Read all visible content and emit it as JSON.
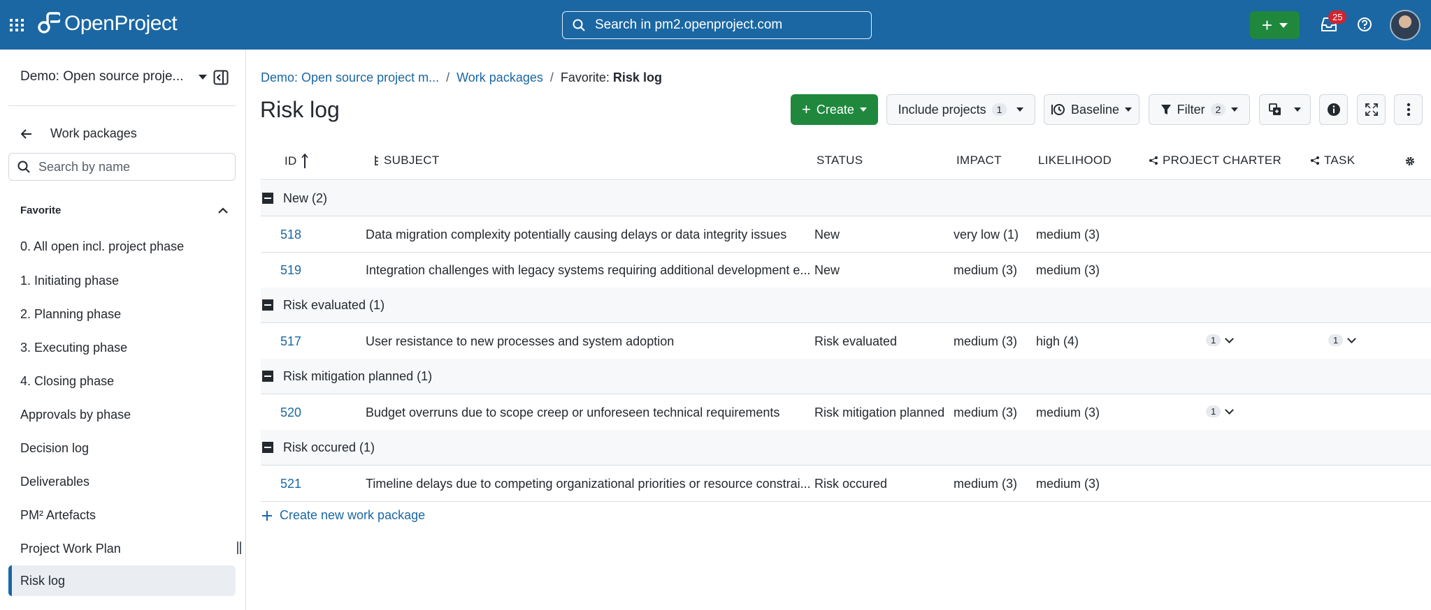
{
  "header": {
    "app_name": "OpenProject",
    "search_placeholder": "Search in pm2.openproject.com",
    "notification_count": "25"
  },
  "sidebar": {
    "project_name": "Demo: Open source proje...",
    "back_label": "Work packages",
    "search_placeholder": "Search by name",
    "section_title": "Favorite",
    "items": [
      {
        "label": "0. All open incl. project phase"
      },
      {
        "label": "1. Initiating phase"
      },
      {
        "label": "2. Planning phase"
      },
      {
        "label": "3. Executing phase"
      },
      {
        "label": "4. Closing phase"
      },
      {
        "label": "Approvals by phase"
      },
      {
        "label": "Decision log"
      },
      {
        "label": "Deliverables"
      },
      {
        "label": "PM² Artefacts"
      },
      {
        "label": "Project Work Plan"
      },
      {
        "label": "Risk log"
      }
    ]
  },
  "breadcrumb": {
    "project": "Demo: Open source project m...",
    "section": "Work packages",
    "current_prefix": "Favorite:",
    "current": "Risk log"
  },
  "page_title": "Risk log",
  "toolbar": {
    "create_label": "Create",
    "include_projects_label": "Include projects",
    "include_projects_count": "1",
    "baseline_label": "Baseline",
    "filter_label": "Filter",
    "filter_count": "2"
  },
  "table": {
    "columns": [
      "ID",
      "SUBJECT",
      "STATUS",
      "IMPACT",
      "LIKELIHOOD",
      "PROJECT CHARTER",
      "TASK"
    ],
    "groups": [
      {
        "title": "New (2)",
        "rows": [
          {
            "id": "518",
            "subject": "Data migration complexity potentially causing delays or data integrity issues",
            "status": "New",
            "impact": "very low (1)",
            "likelihood": "medium (3)",
            "charter": "",
            "task": ""
          },
          {
            "id": "519",
            "subject": "Integration challenges with legacy systems requiring additional development e...",
            "status": "New",
            "impact": "medium (3)",
            "likelihood": "medium (3)",
            "charter": "",
            "task": ""
          }
        ]
      },
      {
        "title": "Risk evaluated (1)",
        "rows": [
          {
            "id": "517",
            "subject": "User resistance to new processes and system adoption",
            "status": "Risk evaluated",
            "impact": "medium (3)",
            "likelihood": "high (4)",
            "charter": "1",
            "task": "1"
          }
        ]
      },
      {
        "title": "Risk mitigation planned (1)",
        "rows": [
          {
            "id": "520",
            "subject": "Budget overruns due to scope creep or unforeseen technical requirements",
            "status": "Risk mitigation planned",
            "impact": "medium (3)",
            "likelihood": "medium (3)",
            "charter": "1",
            "task": ""
          }
        ]
      },
      {
        "title": "Risk occured (1)",
        "rows": [
          {
            "id": "521",
            "subject": "Timeline delays due to competing organizational priorities or resource constrai...",
            "status": "Risk occured",
            "impact": "medium (3)",
            "likelihood": "medium (3)",
            "charter": "",
            "task": ""
          }
        ]
      }
    ],
    "create_new_label": "Create new work package"
  },
  "colors": {
    "header_bg": "#1a67a3",
    "primary_green": "#1f883d",
    "link": "#1a67a3",
    "badge_red": "#d1242f"
  }
}
